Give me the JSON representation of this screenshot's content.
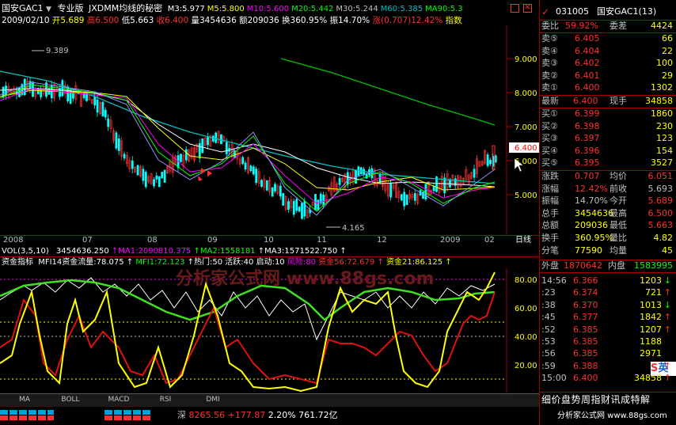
{
  "header": {
    "stock_name": "国安GAC1",
    "down_arrow": "▼",
    "edition": "专业版",
    "formula": "JXDMM均线的秘密",
    "ma": [
      {
        "label": "M3:5.977",
        "color": "#ffffff"
      },
      {
        "label": "M5:5.800",
        "color": "#ffff00"
      },
      {
        "label": "M10:5.600",
        "color": "#ff00ff"
      },
      {
        "label": "M20:5.442",
        "color": "#00ff00"
      },
      {
        "label": "M30:5.244",
        "color": "#c0c0c0"
      },
      {
        "label": "M60:5.385",
        "color": "#00c0c0"
      },
      {
        "label": "MA90:5.3",
        "color": "#00ff00"
      }
    ],
    "info_date": "2009/02/10",
    "info_open": "开5.689",
    "info_high": "高6.500",
    "info_low": "低5.663",
    "info_close": "收6.400",
    "info_vol": "量3454636",
    "info_amt": "额209036",
    "info_turn": "换360.95%",
    "info_amp": "振14.70%",
    "info_chg": "涨(0.707)12.42%",
    "info_tail": "指数"
  },
  "price_axis": [
    "9.000",
    "8.000",
    "7.000",
    "6.000",
    "5.000"
  ],
  "price_marks": {
    "high": "9.389",
    "low": "4.165",
    "last": "6.400"
  },
  "months": [
    "2008",
    "07",
    "08",
    "09",
    "10",
    "11",
    "12",
    "2009",
    "02"
  ],
  "xaxis_label": "日线",
  "vol_line": {
    "head": "VOL(3,5,10)",
    "value": "3454636.250",
    "ma1": "↑MA1:2090810.375",
    "ma2": "↑MA2:1558181",
    "ma3": "↑MA3:1571522.750",
    "ma3_arrow": "↑"
  },
  "ind_line": {
    "head": "资金指标",
    "mfi14": "MFI14资金流量:78.075",
    "arrow1": "↑",
    "mfi1": "MFI1:72.123",
    "hot": "↑热门:50",
    "active": "活跃:40",
    "start": "启动:10",
    "risk": "风险:80",
    "fund56": "资金56:72.679",
    "arrow2": "↑",
    "fund21": "资金21:86.125",
    "arrow3": "↑"
  },
  "ind_axis": [
    "80.00",
    "60.00",
    "40.00",
    "20.00"
  ],
  "watermark": "分析家公式网 www.88gs.com",
  "bottom_tabs": [
    "MA",
    "BOLL",
    "MACD",
    "RSI",
    "DMI"
  ],
  "status": {
    "index": "深",
    "value": "8265.56",
    "change": "+177.87",
    "pct": "2.20%",
    "amount": "761.72亿"
  },
  "quote": {
    "code": "031005",
    "name": "国安GAC1(13)",
    "webi_label": "委比",
    "webi": "59.92%",
    "weicha_label": "委差",
    "weicha": "4424",
    "asks": [
      {
        "label": "卖⑤",
        "price": "6.405",
        "vol": "66"
      },
      {
        "label": "卖④",
        "price": "6.404",
        "vol": "22"
      },
      {
        "label": "卖③",
        "price": "6.402",
        "vol": "100"
      },
      {
        "label": "卖②",
        "price": "6.401",
        "vol": "29"
      },
      {
        "label": "卖①",
        "price": "6.400",
        "vol": "1302"
      }
    ],
    "latest_label": "最新",
    "latest": "6.400",
    "now_vol_label": "现手",
    "now_vol": "34858",
    "bids": [
      {
        "label": "买①",
        "price": "6.399",
        "vol": "1860"
      },
      {
        "label": "买②",
        "price": "6.398",
        "vol": "230"
      },
      {
        "label": "买③",
        "price": "6.397",
        "vol": "123"
      },
      {
        "label": "买④",
        "price": "6.396",
        "vol": "154"
      },
      {
        "label": "买⑤",
        "price": "6.395",
        "vol": "3527"
      }
    ],
    "stats": [
      [
        "涨跌",
        "0.707",
        "均价",
        "6.051"
      ],
      [
        "涨幅",
        "12.42%",
        "前收",
        "5.693"
      ],
      [
        "振幅",
        "14.70%",
        "今开",
        "5.689"
      ],
      [
        "总手",
        "3454636",
        "最高",
        "6.500"
      ],
      [
        "总额",
        "209036",
        "最低",
        "5.663"
      ],
      [
        "换手",
        "360.95%",
        "量比",
        "4.82"
      ],
      [
        "分笔",
        "77590",
        "均量",
        "45"
      ]
    ],
    "outer_label": "外盘",
    "outer": "1870642",
    "inner_label": "内盘",
    "inner": "1583995",
    "ticks": [
      {
        "time": "14:56",
        "price": "6.366",
        "vol": "1203",
        "dir": "↓"
      },
      {
        "time": ":23",
        "price": "6.374",
        "vol": "721",
        "dir": "↑"
      },
      {
        "time": ":38",
        "price": "6.370",
        "vol": "1013",
        "dir": "↓"
      },
      {
        "time": ":45",
        "price": "6.377",
        "vol": "1842",
        "dir": "↑"
      },
      {
        "time": ":52",
        "price": "6.385",
        "vol": "1207",
        "dir": "↑"
      },
      {
        "time": ":53",
        "price": "6.385",
        "vol": "1188",
        "dir": ""
      },
      {
        "time": ":56",
        "price": "6.385",
        "vol": "2971",
        "dir": ""
      },
      {
        "time": ":59",
        "price": "6.388",
        "vol": "",
        "dir": "↑"
      },
      {
        "time": "15:00",
        "price": "6.400",
        "vol": "34858",
        "dir": "↑"
      }
    ],
    "tabs_text": "细价盘势周指财讯成特解",
    "site": "分析家公式网 www.88gs.com",
    "badge": "英"
  },
  "colors": {
    "up": "#ff3030",
    "down": "#00ffff",
    "label_green": "#00ff00",
    "yellow": "#ffff00",
    "grid_red": "#a00000"
  }
}
